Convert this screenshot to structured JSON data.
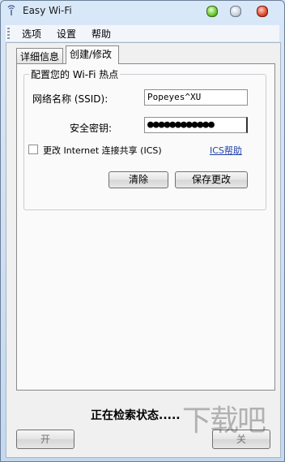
{
  "window": {
    "title": "Easy Wi-Fi"
  },
  "menu": {
    "items": [
      "选项",
      "设置",
      "帮助"
    ]
  },
  "tabs": [
    {
      "label": "详细信息"
    },
    {
      "label": "创建/修改"
    }
  ],
  "group": {
    "title": "配置您的 Wi-Fi 热点",
    "ssid_label": "网络名称 (SSID):",
    "ssid_value": "Popeyes^XU",
    "key_label": "安全密钥:",
    "key_value": "●●●●●●●●●●●●",
    "ics_checkbox_label": "更改 Internet 连接共享 (ICS)",
    "ics_checked": false,
    "ics_help_link": "ICS帮助",
    "clear_button": "清除",
    "save_button": "保存更改"
  },
  "status": {
    "text": "正在检索状态....."
  },
  "bottom": {
    "on_button": "开",
    "off_button": "关"
  },
  "watermark": {
    "text": "下载吧"
  }
}
